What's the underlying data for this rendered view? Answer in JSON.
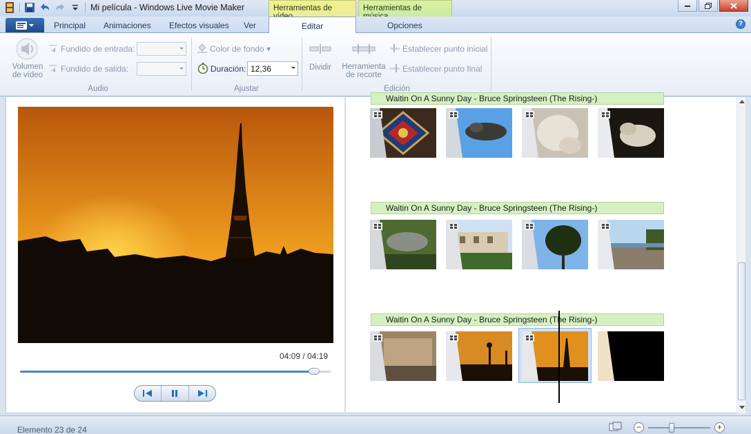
{
  "window": {
    "title": "Mi película - Windows Live Movie Maker",
    "contextual_tabs": [
      "Herramientas de vídeo",
      "Herramientas de música"
    ]
  },
  "quick_access": {
    "icons": [
      "film-icon",
      "save-icon",
      "undo-icon",
      "redo-icon",
      "customize-icon"
    ]
  },
  "tabs": [
    "Principal",
    "Animaciones",
    "Efectos visuales",
    "Ver",
    "Editar",
    "Opciones"
  ],
  "active_tab": "Editar",
  "ribbon": {
    "audio": {
      "volume_line1": "Volumen",
      "volume_line2": "de vídeo",
      "fade_in": "Fundido de entrada:",
      "fade_out": "Fundido de salida:",
      "group": "Audio"
    },
    "ajustar": {
      "bg_color": "Color de fondo",
      "duration_label": "Duración:",
      "duration_value": "12,36",
      "group": "Ajustar"
    },
    "edicion": {
      "split": "Dividir",
      "trim_line1": "Herramienta",
      "trim_line2": "de recorte",
      "set_start": "Establecer punto inicial",
      "set_end": "Establecer punto final",
      "group": "Edición"
    }
  },
  "preview": {
    "time": "04:09 / 04:19",
    "progress": 0.96
  },
  "storyboard": {
    "music_track": "Waitin On A Sunny Day - Bruce Springsteen (The Rising-)"
  },
  "status": {
    "item": "Elemento 23 de 24",
    "zoom_minus": "−",
    "zoom_plus": "+"
  },
  "colors": {
    "accent": "#2b5797",
    "music_bar": "#d6f0c2",
    "contextual_video": "#f3ef8e",
    "contextual_music": "#d4eea0"
  }
}
